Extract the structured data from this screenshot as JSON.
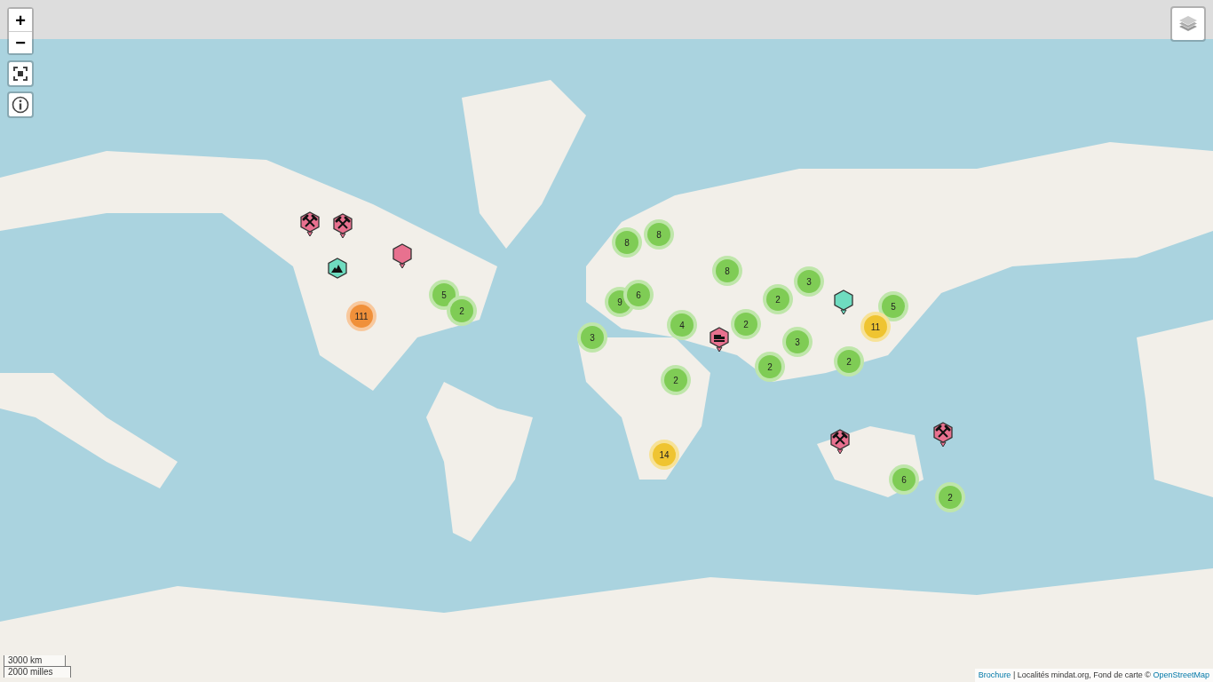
{
  "zoom_controls": [
    "+",
    "−"
  ],
  "clusters": [
    {
      "count": "8",
      "color": "#7fcc55"
    },
    {
      "count": "8",
      "color": "#7fcc55"
    },
    {
      "count": "8",
      "color": "#7fcc55"
    },
    {
      "count": "3",
      "color": "#7fcc55"
    },
    {
      "count": "111",
      "color": "#f0903a"
    },
    {
      "count": "5",
      "color": "#7fcc55"
    },
    {
      "count": "2",
      "color": "#7fcc55"
    },
    {
      "count": "9",
      "color": "#7fcc55"
    },
    {
      "count": "6",
      "color": "#7fcc55"
    },
    {
      "count": "2",
      "color": "#7fcc55"
    },
    {
      "count": "5",
      "color": "#7fcc55"
    },
    {
      "count": "3",
      "color": "#7fcc55"
    },
    {
      "count": "4",
      "color": "#7fcc55"
    },
    {
      "count": "2",
      "color": "#7fcc55"
    },
    {
      "count": "3",
      "color": "#7fcc55"
    },
    {
      "count": "11",
      "color": "#efc431"
    },
    {
      "count": "2",
      "color": "#7fcc55"
    },
    {
      "count": "2",
      "color": "#7fcc55"
    },
    {
      "count": "2",
      "color": "#7fcc55"
    },
    {
      "count": "14",
      "color": "#efc431"
    },
    {
      "count": "6",
      "color": "#7fcc55"
    },
    {
      "count": "2",
      "color": "#7fcc55"
    }
  ],
  "markers": [
    {
      "kind": "mine",
      "color": "#e8718f"
    },
    {
      "kind": "mine",
      "color": "#e8718f"
    },
    {
      "kind": "plain",
      "color": "#e8718f"
    },
    {
      "kind": "mountain",
      "color": "#6fdcc0"
    },
    {
      "kind": "plain",
      "color": "#6fdcc0"
    },
    {
      "kind": "factory",
      "color": "#e8718f"
    },
    {
      "kind": "mine",
      "color": "#e8718f"
    },
    {
      "kind": "mine",
      "color": "#e8718f"
    }
  ],
  "scale": [
    "3000 km",
    "2000 milles"
  ],
  "attribution": {
    "link": "Brochure",
    "text": " | Localités mindat.org, Fond de carte © ",
    "source": "OpenStreetMap"
  }
}
